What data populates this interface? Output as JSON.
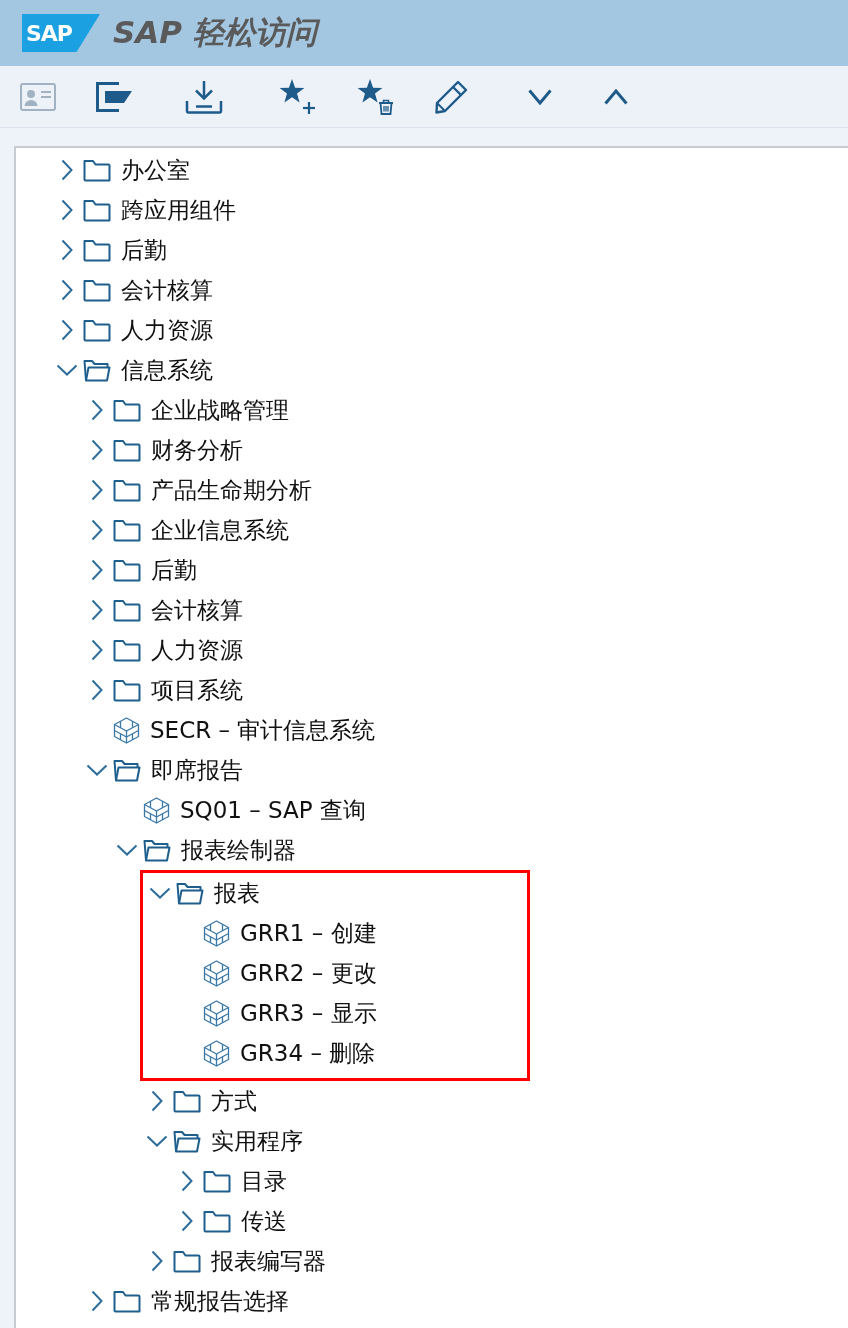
{
  "header": {
    "logo": "SAP",
    "title": "SAP 轻松访问"
  },
  "toolbar": [
    {
      "kind": "person-card",
      "disabled": true
    },
    {
      "kind": "folder",
      "disabled": false
    },
    {
      "kind": "download",
      "disabled": false
    },
    {
      "kind": "star-add",
      "disabled": false
    },
    {
      "kind": "star-delete",
      "disabled": false
    },
    {
      "kind": "edit",
      "disabled": false
    },
    {
      "kind": "expand",
      "disabled": false
    },
    {
      "kind": "collapse",
      "disabled": false
    }
  ],
  "tree": [
    {
      "label": "办公室",
      "kind": "folder",
      "expanded": false,
      "highlighted": false
    },
    {
      "label": "跨应用组件",
      "kind": "folder",
      "expanded": false,
      "highlighted": false
    },
    {
      "label": "后勤",
      "kind": "folder",
      "expanded": false,
      "highlighted": false
    },
    {
      "label": "会计核算",
      "kind": "folder",
      "expanded": false,
      "highlighted": false
    },
    {
      "label": "人力资源",
      "kind": "folder",
      "expanded": false,
      "highlighted": false
    },
    {
      "label": "信息系统",
      "kind": "folder",
      "expanded": true,
      "highlighted": false,
      "children": [
        {
          "label": "企业战略管理",
          "kind": "folder",
          "expanded": false,
          "highlighted": false
        },
        {
          "label": "财务分析",
          "kind": "folder",
          "expanded": false,
          "highlighted": false
        },
        {
          "label": "产品生命期分析",
          "kind": "folder",
          "expanded": false,
          "highlighted": false
        },
        {
          "label": "企业信息系统",
          "kind": "folder",
          "expanded": false,
          "highlighted": false
        },
        {
          "label": "后勤",
          "kind": "folder",
          "expanded": false,
          "highlighted": false
        },
        {
          "label": "会计核算",
          "kind": "folder",
          "expanded": false,
          "highlighted": false
        },
        {
          "label": "人力资源",
          "kind": "folder",
          "expanded": false,
          "highlighted": false
        },
        {
          "label": "项目系统",
          "kind": "folder",
          "expanded": false,
          "highlighted": false
        },
        {
          "label": "SECR – 审计信息系统",
          "kind": "transaction",
          "highlighted": false
        },
        {
          "label": "即席报告",
          "kind": "folder",
          "expanded": true,
          "highlighted": false,
          "children": [
            {
              "label": "SQ01 – SAP 查询",
              "kind": "transaction",
              "highlighted": false
            },
            {
              "label": "报表绘制器",
              "kind": "folder",
              "expanded": true,
              "highlighted": false,
              "children": [
                {
                  "label": "报表",
                  "kind": "folder",
                  "expanded": true,
                  "highlighted": true,
                  "children": [
                    {
                      "label": "GRR1 – 创建",
                      "kind": "transaction",
                      "highlighted": false
                    },
                    {
                      "label": "GRR2 – 更改",
                      "kind": "transaction",
                      "highlighted": false
                    },
                    {
                      "label": "GRR3 – 显示",
                      "kind": "transaction",
                      "highlighted": false
                    },
                    {
                      "label": "GR34 – 删除",
                      "kind": "transaction",
                      "highlighted": false
                    }
                  ]
                },
                {
                  "label": "方式",
                  "kind": "folder",
                  "expanded": false,
                  "highlighted": false
                },
                {
                  "label": "实用程序",
                  "kind": "folder",
                  "expanded": true,
                  "highlighted": false,
                  "children": [
                    {
                      "label": "目录",
                      "kind": "folder",
                      "expanded": false,
                      "highlighted": false
                    },
                    {
                      "label": "传送",
                      "kind": "folder",
                      "expanded": false,
                      "highlighted": false
                    }
                  ]
                },
                {
                  "label": "报表编写器",
                  "kind": "folder",
                  "expanded": false,
                  "highlighted": false
                }
              ]
            }
          ]
        },
        {
          "label": "常规报告选择",
          "kind": "folder",
          "expanded": false,
          "highlighted": false
        }
      ]
    }
  ]
}
